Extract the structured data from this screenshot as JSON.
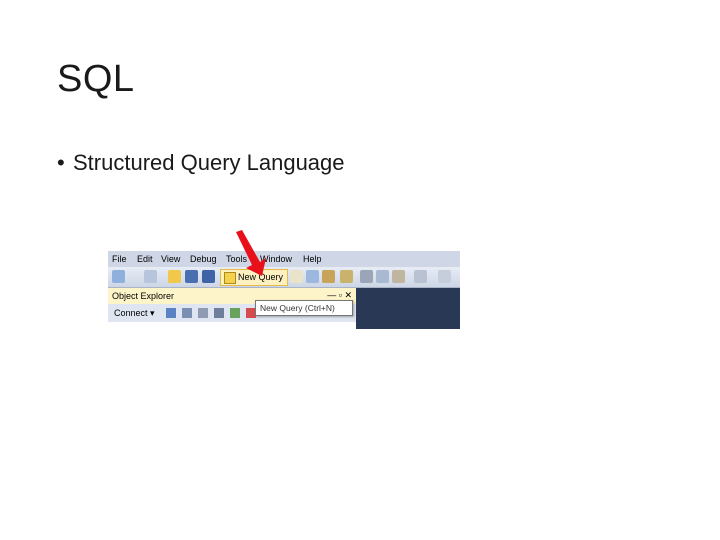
{
  "slide": {
    "title": "SQL",
    "bullet": "Structured Query Language"
  },
  "ssms": {
    "menu": [
      "File",
      "Edit",
      "View",
      "Debug",
      "Tools",
      "Window",
      "Help"
    ],
    "toolbar": {
      "new_query_label": "New Query"
    },
    "object_explorer": {
      "title": "Object Explorer",
      "pin_glyph": "— ▫",
      "close_glyph": "✕",
      "connect_label": "Connect ▾"
    },
    "tooltip": "New Query (Ctrl+N)"
  },
  "colors": {
    "arrow": "#e8101a",
    "menubar": "#cfd6e5",
    "dark_pane": "#293955",
    "oe_header": "#fef4c9"
  }
}
